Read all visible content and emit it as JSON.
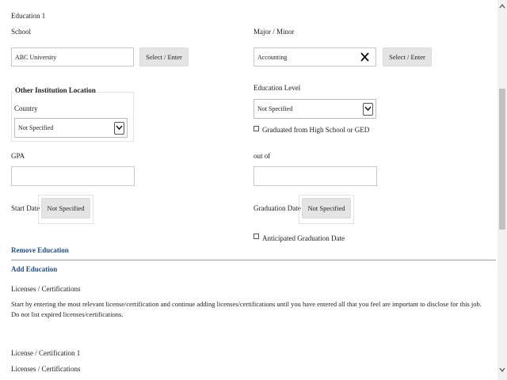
{
  "education": {
    "section_title": "Education 1",
    "school": {
      "label": "School",
      "value": "ABC University",
      "select_label": "Select / Enter"
    },
    "major": {
      "label": "Major / Minor",
      "value": "Accounting",
      "select_label": "Select / Enter"
    },
    "other_location": {
      "legend": "Other Institution Location",
      "country_label": "Country",
      "country_value": "Not Specified"
    },
    "level": {
      "label": "Education Level",
      "value": "Not Specified"
    },
    "hs_checkbox_label": "Graduated from High School or GED",
    "gpa": {
      "label": "GPA",
      "value": ""
    },
    "out_of": {
      "label": "out of",
      "value": ""
    },
    "start_date": {
      "label": "Start Date",
      "button": "Not Specified"
    },
    "graduation_date": {
      "label": "Graduation Date",
      "button": "Not Specified"
    },
    "anticipated_label": "Anticipated Graduation Date",
    "remove_link": "Remove Education",
    "add_link": "Add Education"
  },
  "licenses": {
    "heading": "Licenses / Certifications",
    "instructions_line1": "Start by entering the most relevant license/certification and continue adding licenses/certifications until you have entered all that you feel are important to disclose for this job.",
    "instructions_line2": "Do not list expired licenses/certifications.",
    "item_title": "License / Certification 1",
    "item_field_label": "Licenses / Certifications"
  }
}
